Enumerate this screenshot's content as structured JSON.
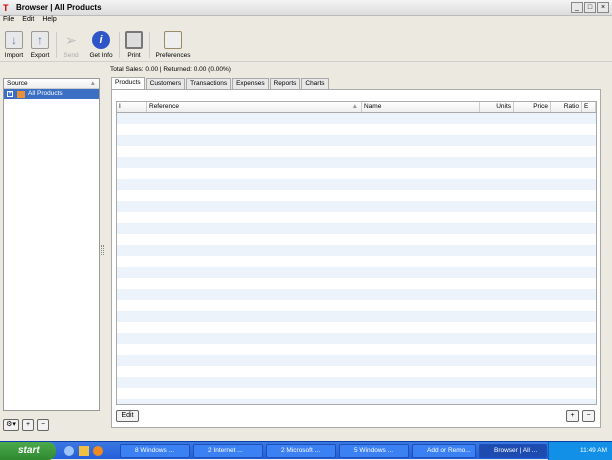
{
  "window": {
    "title": "Browser | All Products",
    "min": "_",
    "max": "□",
    "close": "×"
  },
  "menu": [
    "File",
    "Edit",
    "Help"
  ],
  "toolbar": [
    {
      "label": "Import",
      "color": "#5a7fb0"
    },
    {
      "label": "Export",
      "color": "#5a7fb0"
    },
    {
      "label": "Send",
      "color": "#bbbbbb"
    },
    {
      "label": "Get Info",
      "color": "#2e56c8"
    },
    {
      "label": "Print",
      "color": "#888888"
    },
    {
      "label": "Preferences",
      "color": "#c9b99a"
    }
  ],
  "status": "Total Sales: 0.00 | Returned: 0.00 (0.00%)",
  "source": {
    "header": "Source",
    "item": "All Products"
  },
  "tabs": [
    "Products",
    "Customers",
    "Transactions",
    "Expenses",
    "Reports",
    "Charts"
  ],
  "columns": [
    "I",
    "Reference",
    "Name",
    "Units",
    "Price",
    "Ratio",
    "E"
  ],
  "buttons": {
    "edit": "Edit",
    "add": "+",
    "remove": "−",
    "gear": "⚙▾"
  },
  "taskbar": {
    "start": "start",
    "tasks": [
      "8 Windows ...",
      "2 Internet ...",
      "2 Microsoft ...",
      "5 Windows ...",
      "Add or Remo...",
      "Browser | All ..."
    ],
    "clock": "11:49 AM"
  }
}
